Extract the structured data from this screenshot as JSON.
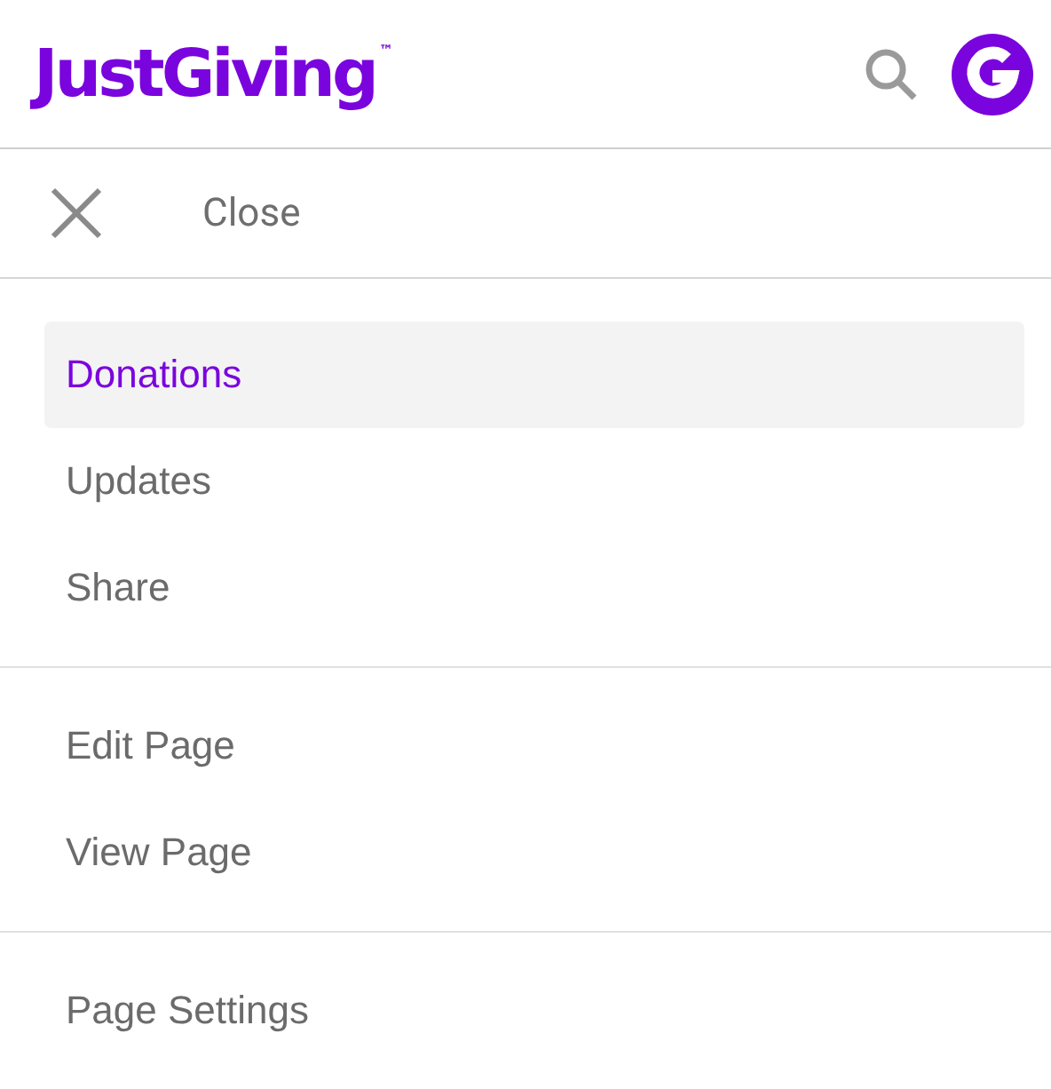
{
  "header": {
    "logo": "JustGiving",
    "trademark": "™"
  },
  "close": {
    "label": "Close"
  },
  "menu_sections": [
    {
      "items": [
        {
          "label": "Donations",
          "selected": true
        },
        {
          "label": "Updates",
          "selected": false
        },
        {
          "label": "Share",
          "selected": false
        }
      ]
    },
    {
      "items": [
        {
          "label": "Edit Page",
          "selected": false
        },
        {
          "label": "View Page",
          "selected": false
        }
      ]
    },
    {
      "items": [
        {
          "label": "Page Settings",
          "selected": false
        }
      ]
    }
  ]
}
